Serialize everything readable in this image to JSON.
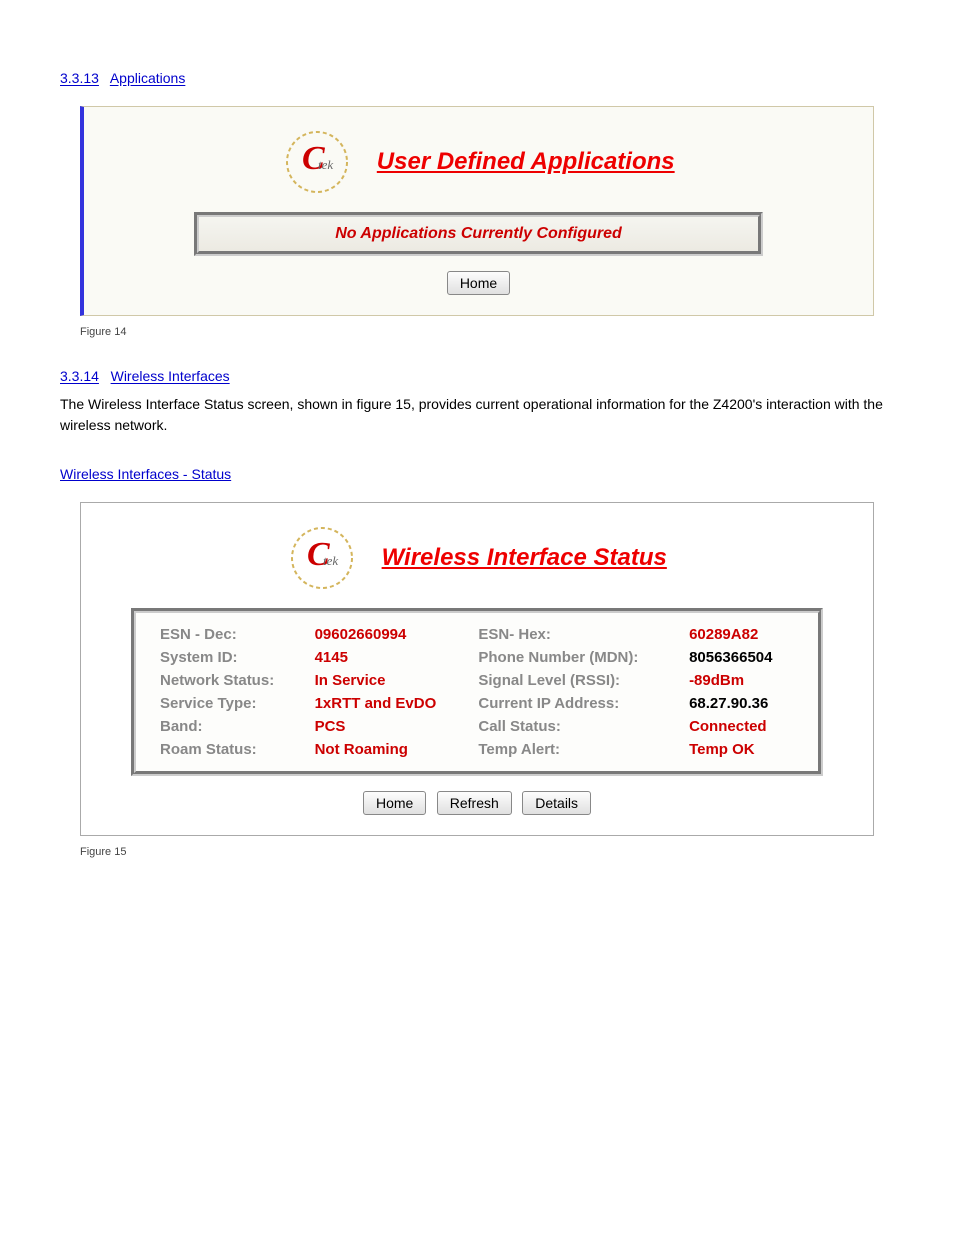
{
  "section1": {
    "num": "3.3.13",
    "title": "Applications"
  },
  "panel1": {
    "title": "User Defined Applications",
    "message": "No Applications Currently Configured",
    "home_btn": "Home"
  },
  "fig1_caption": "Figure 14",
  "section2": {
    "num": "3.3.14",
    "title": "Wireless Interfaces"
  },
  "para": "The Wireless Interface Status screen, shown in figure 15, provides current operational information for the Z4200's interaction with the wireless network.",
  "subhead": "Wireless Interfaces - Status",
  "panel2": {
    "title": "Wireless Interface Status",
    "rows": [
      {
        "l1": "ESN - Dec:",
        "v1": "09602660994",
        "c1": "val-red",
        "l2": "ESN- Hex:",
        "v2": "60289A82",
        "c2": "val-red"
      },
      {
        "l1": "System ID:",
        "v1": "4145",
        "c1": "val-red",
        "l2": "Phone Number (MDN):",
        "v2": "8056366504",
        "c2": "val-black"
      },
      {
        "l1": "Network Status:",
        "v1": "In Service",
        "c1": "val-red",
        "l2": "Signal Level (RSSI):",
        "v2": "-89dBm",
        "c2": "val-red"
      },
      {
        "l1": "Service Type:",
        "v1": "1xRTT and EvDO",
        "c1": "val-red",
        "l2": "Current IP Address:",
        "v2": "68.27.90.36",
        "c2": "val-black"
      },
      {
        "l1": "Band:",
        "v1": "PCS",
        "c1": "val-red",
        "l2": "Call Status:",
        "v2": "Connected",
        "c2": "val-red"
      },
      {
        "l1": "Roam Status:",
        "v1": "Not Roaming",
        "c1": "val-red",
        "l2": "Temp Alert:",
        "v2": "Temp OK",
        "c2": "val-red"
      }
    ],
    "buttons": {
      "home": "Home",
      "refresh": "Refresh",
      "details": "Details"
    }
  },
  "fig2_caption": "Figure 15"
}
